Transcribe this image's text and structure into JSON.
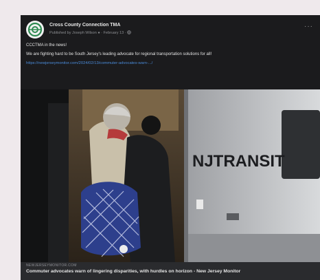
{
  "post": {
    "page_name": "Cross County Connection TMA",
    "meta": "Published by Joseph Wilson ● · February 13 · ",
    "more_glyph": "···",
    "text_line1": "CCCTMA in the news!",
    "text_line2": "We are fighting hard to be South Jersey's leading advocate for regional transportation solutions for all!",
    "link": "https://newjerseymonitor.com/2024/02/13/commuter-advocates-warn-.../"
  },
  "photo": {
    "sign_text": "NJTRANSIT"
  },
  "link_preview": {
    "domain": "NEWJERSEYMONITOR.COM",
    "title": "Commuter advocates warn of lingering disparities, with hurdles on horizon - New Jersey Monitor"
  },
  "colors": {
    "page_bg": "#efe9ec",
    "card_bg": "#1b1b1d",
    "link": "#4a8bd9",
    "avatar_logo": "#2f8b52"
  }
}
